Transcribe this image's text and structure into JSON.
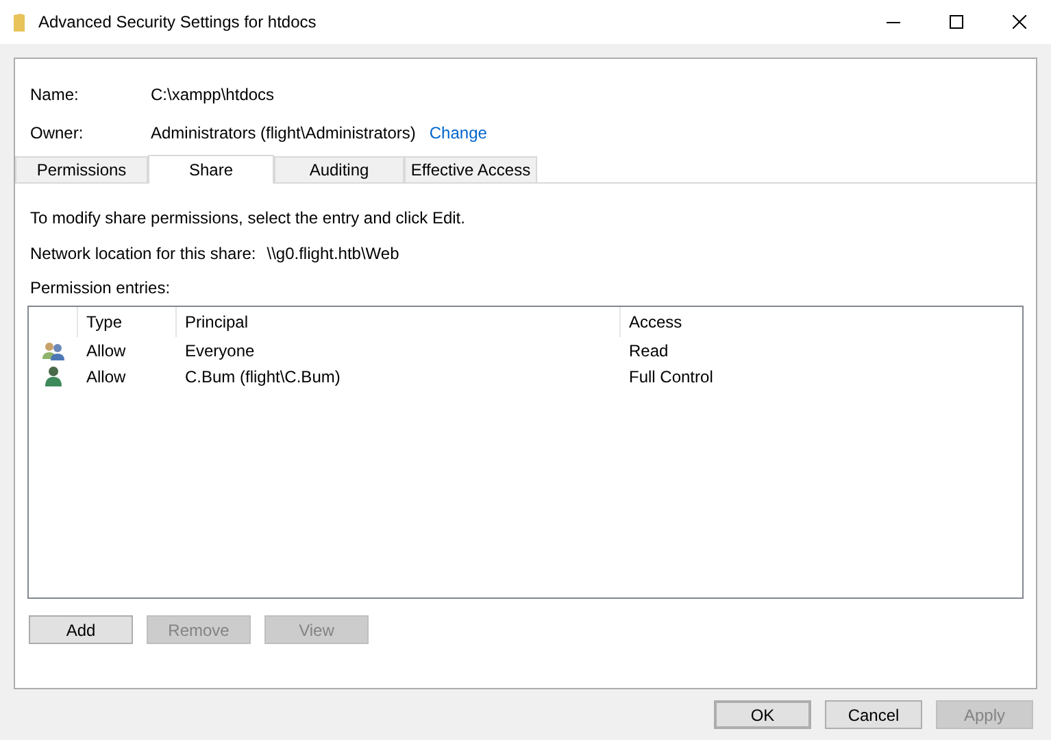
{
  "window": {
    "title": "Advanced Security Settings for htdocs"
  },
  "name": {
    "label": "Name:",
    "value": "C:\\xampp\\htdocs"
  },
  "owner": {
    "label": "Owner:",
    "value": "Administrators (flight\\Administrators)",
    "link": "Change"
  },
  "tabs": [
    {
      "label": "Permissions",
      "selected": false
    },
    {
      "label": "Share",
      "selected": true
    },
    {
      "label": "Auditing",
      "selected": false
    },
    {
      "label": "Effective Access",
      "selected": false
    }
  ],
  "instructions": "To modify share permissions, select the entry and click Edit.",
  "network_location": {
    "label": "Network location for this share:",
    "value": "\\\\g0.flight.htb\\Web"
  },
  "entries_label": "Permission entries:",
  "table": {
    "columns": [
      "Type",
      "Principal",
      "Access"
    ],
    "rows": [
      {
        "kind": "group",
        "type": "Allow",
        "principal": "Everyone",
        "access": "Read"
      },
      {
        "kind": "user",
        "type": "Allow",
        "principal": "C.Bum (flight\\C.Bum)",
        "access": "Full Control"
      }
    ]
  },
  "entry_buttons": [
    {
      "label": "Add",
      "disabled": false
    },
    {
      "label": "Remove",
      "disabled": true
    },
    {
      "label": "View",
      "disabled": true
    }
  ],
  "dialog_buttons": [
    {
      "label": "OK",
      "disabled": false,
      "default": true
    },
    {
      "label": "Cancel",
      "disabled": false,
      "default": false
    },
    {
      "label": "Apply",
      "disabled": true,
      "default": false
    }
  ]
}
